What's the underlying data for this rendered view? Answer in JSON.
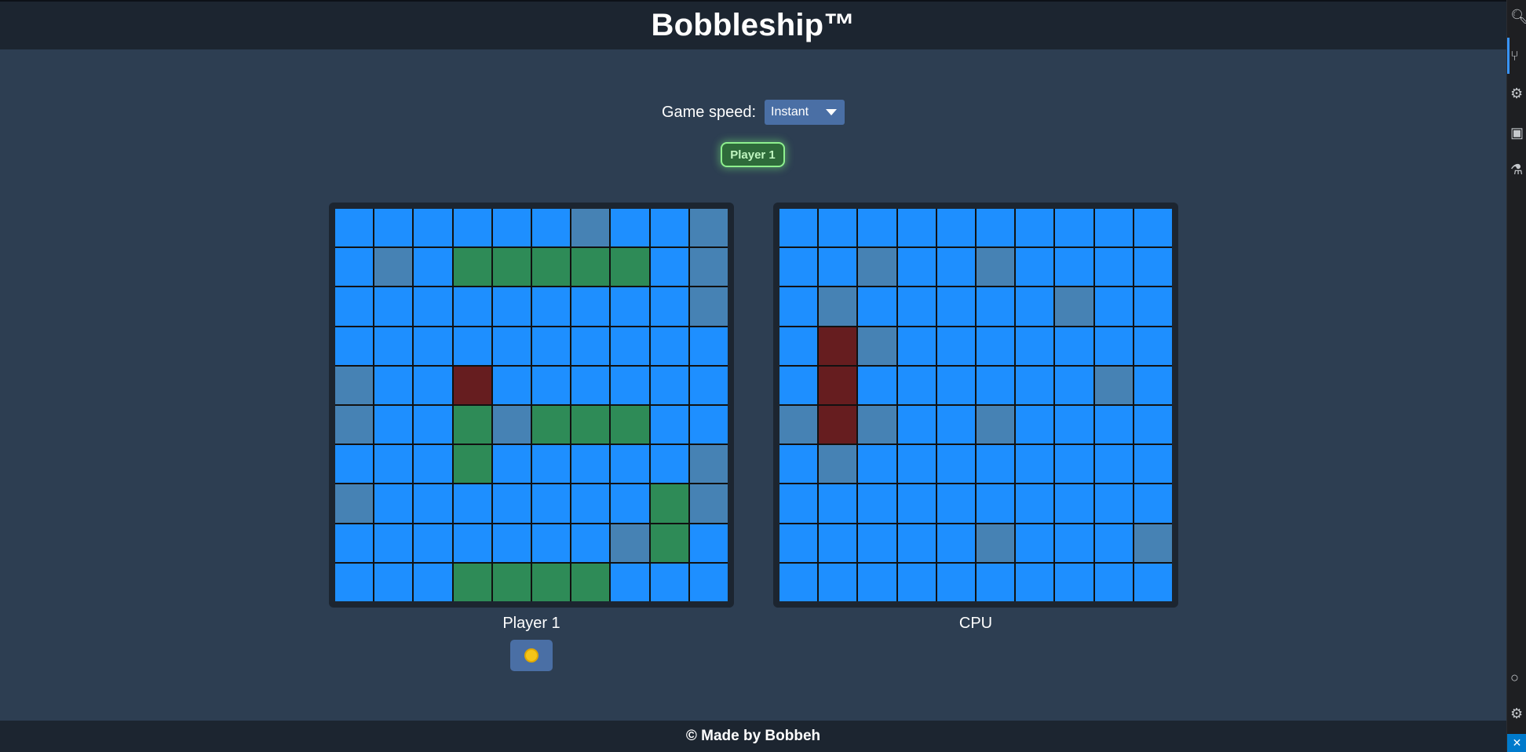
{
  "header": {
    "title": "Bobbleship™"
  },
  "controls": {
    "speed_label": "Game speed:",
    "speed_value": "Instant",
    "turn_badge": "Player 1"
  },
  "boards": [
    {
      "label": "Player 1",
      "cells": [
        "......m..m",
        ".m.SSSSS.m",
        ".........m",
        "..........",
        "m..H......",
        "m..SmSSS..",
        "...S.....m",
        "m.......Sm",
        ".......mS.",
        "...SSSS..."
      ]
    },
    {
      "label": "CPU",
      "cells": [
        "..........",
        "..m..m....",
        ".m.....m..",
        ".Hm.......",
        ".H......m.",
        "mHm..m....",
        ".m........",
        "..........",
        ".....m...m",
        ".........."
      ]
    }
  ],
  "cell_legend": {
    ".": "water",
    "m": "miss",
    "S": "ship",
    "H": "hit"
  },
  "colors": {
    "water": "#1e8fff",
    "miss": "#4682b4",
    "ship": "#2e8b57",
    "hit": "#661d1f"
  },
  "theme_toggle_icon": "sun-icon",
  "footer": {
    "text": "© Made by Bobbeh"
  }
}
